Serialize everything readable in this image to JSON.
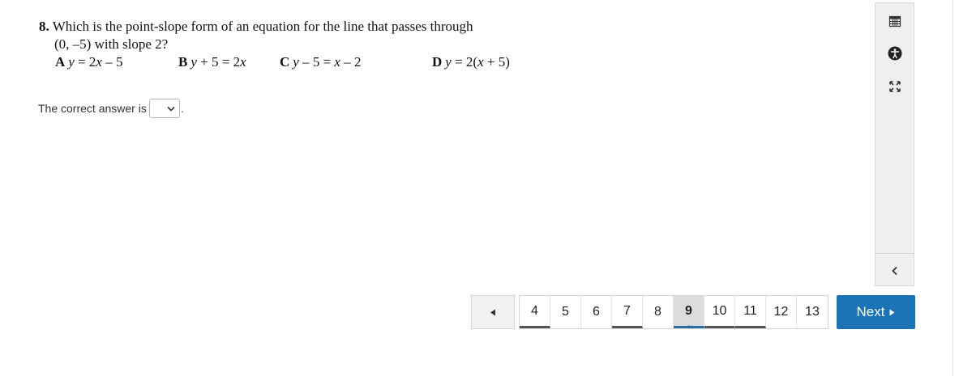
{
  "question": {
    "number": "8.",
    "text_line1": "Which is the point-slope form of an equation for the line that passes through",
    "text_line2": "(0, –5) with slope 2?",
    "choices": [
      {
        "letter": "A",
        "parts": [
          [
            "v",
            "y"
          ],
          [
            "t",
            " = 2"
          ],
          [
            "v",
            "x"
          ],
          [
            "t",
            " – 5"
          ]
        ]
      },
      {
        "letter": "B",
        "parts": [
          [
            "v",
            "y"
          ],
          [
            "t",
            " + 5 = 2"
          ],
          [
            "v",
            "x"
          ]
        ]
      },
      {
        "letter": "C",
        "parts": [
          [
            "v",
            "y"
          ],
          [
            "t",
            " – 5 = "
          ],
          [
            "v",
            "x"
          ],
          [
            "t",
            " – 2"
          ]
        ]
      },
      {
        "letter": "D",
        "parts": [
          [
            "v",
            "y"
          ],
          [
            "t",
            " = 2("
          ],
          [
            "v",
            "x"
          ],
          [
            "t",
            " + 5)"
          ]
        ]
      }
    ]
  },
  "answer": {
    "label": "The correct answer is",
    "selected_value": "",
    "suffix": "."
  },
  "toolbar": {
    "icons": [
      "calendar-grid-icon",
      "accessibility-icon",
      "expand-icon",
      "collapse-chevron-icon"
    ]
  },
  "pagination": {
    "prev_icon": "left-triangle-icon",
    "pages": [
      "4",
      "5",
      "6",
      "7",
      "8",
      "9",
      "10",
      "11",
      "12",
      "13"
    ],
    "current": "9",
    "underlined": [
      "4",
      "7",
      "10",
      "11"
    ],
    "next_label": "Next",
    "next_icon": "right-triangle-icon"
  },
  "colors": {
    "next_button": "#1b74b6",
    "current_indicator": "#2d6ca2",
    "toolbar_bg": "#efefef"
  }
}
